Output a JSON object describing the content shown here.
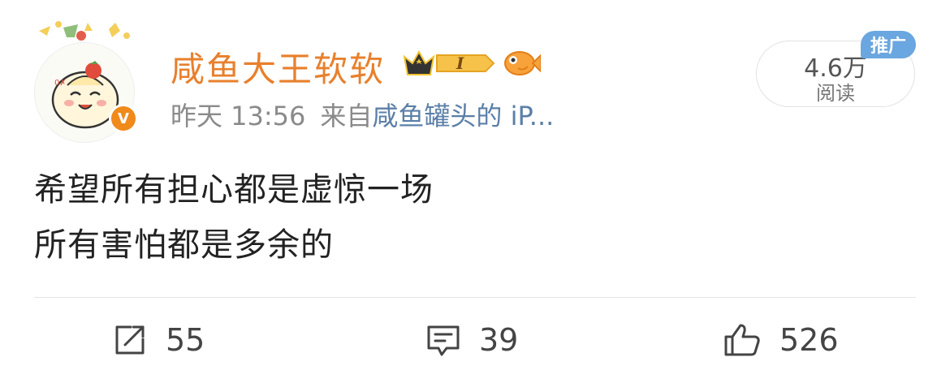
{
  "post": {
    "username": "咸鱼大王软软",
    "time": "昨天 13:56",
    "source_prefix": "来自",
    "source_name": "咸鱼罐头的 iP...",
    "vip_letter": "V",
    "rank_letter": "I",
    "text_lines": [
      "希望所有担心都是虚惊一场",
      "所有害怕都是多余的"
    ]
  },
  "reads": {
    "count": "4.6万",
    "label": "阅读"
  },
  "promo_tag": "推广",
  "actions": {
    "repost_count": "55",
    "comment_count": "39",
    "like_count": "526"
  },
  "colors": {
    "username": "#e8802d",
    "source_link": "#5b7fa8",
    "promo": "#6aa6df",
    "vip": "#f08a1a"
  },
  "icons": {
    "repost": "share-arrow-icon",
    "comment": "comment-bubble-icon",
    "like": "thumbs-up-icon"
  }
}
